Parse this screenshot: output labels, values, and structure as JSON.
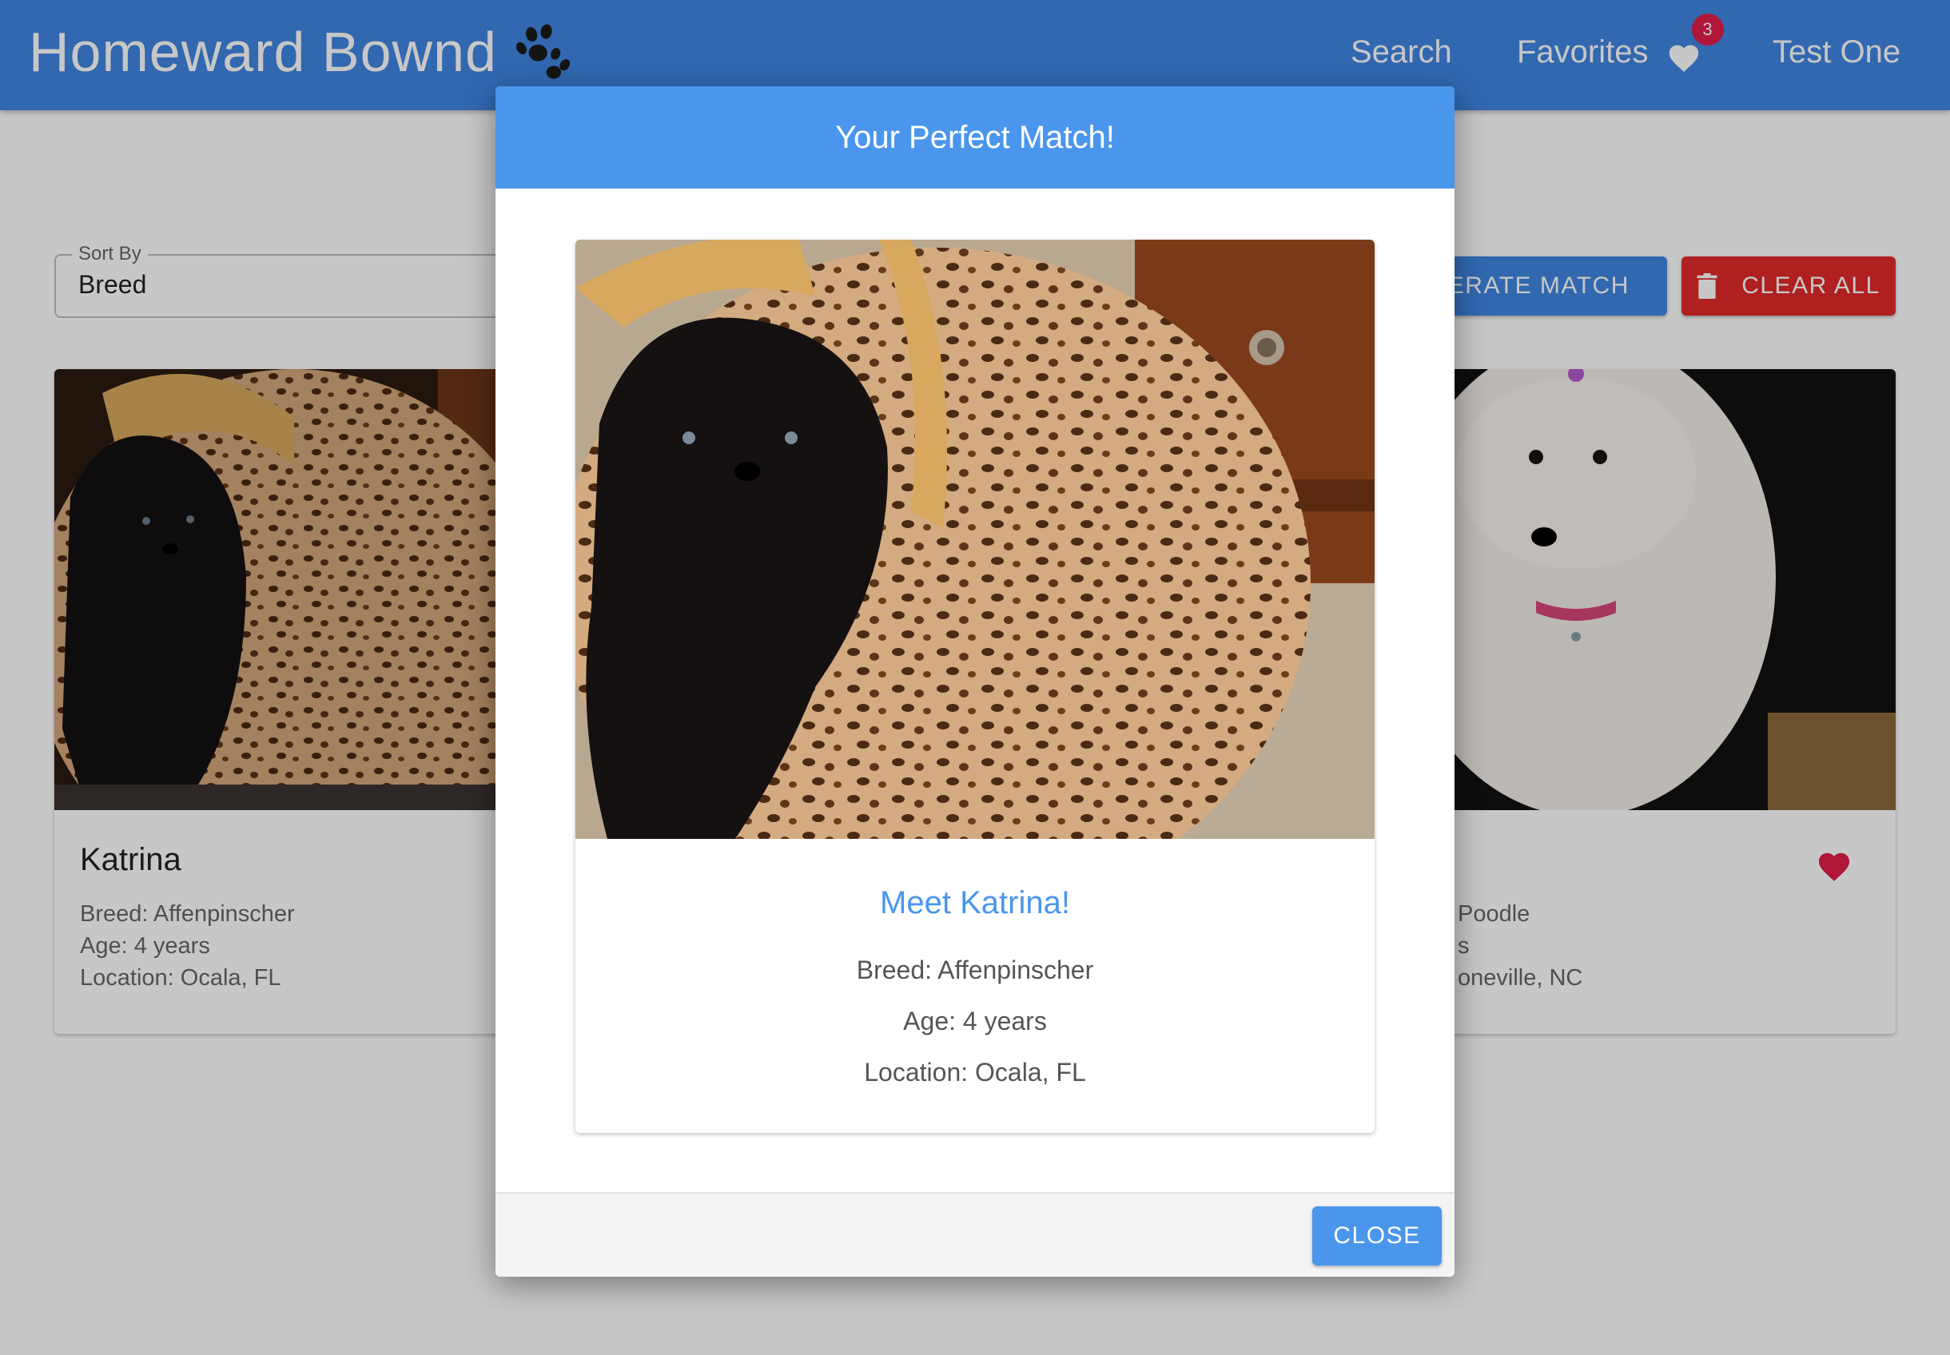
{
  "header": {
    "brand": "Homeward Bownd",
    "nav": {
      "search": "Search",
      "favorites": "Favorites",
      "favorites_count": "3",
      "user": "Test One"
    }
  },
  "controls": {
    "sort_label": "Sort By",
    "sort_value": "Breed",
    "generate_match_label": "ENERATE MATCH",
    "clear_all_label": "CLEAR ALL"
  },
  "cards": [
    {
      "name": "Katrina",
      "breed": "Breed: Affenpinscher",
      "age": "Age: 4 years",
      "location": "Location: Ocala, FL"
    },
    {
      "breed": "Poodle",
      "age": "s",
      "location": "oneville, NC"
    }
  ],
  "dialog": {
    "title": "Your Perfect Match!",
    "meet": "Meet Katrina!",
    "breed": "Breed: Affenpinscher",
    "age": "Age: 4 years",
    "location": "Location: Ocala, FL",
    "close_label": "CLOSE"
  },
  "colors": {
    "primary": "#3f86e2",
    "dialog_primary": "#4a96ed",
    "danger": "#e12a2a",
    "favorite": "#e11d48"
  }
}
